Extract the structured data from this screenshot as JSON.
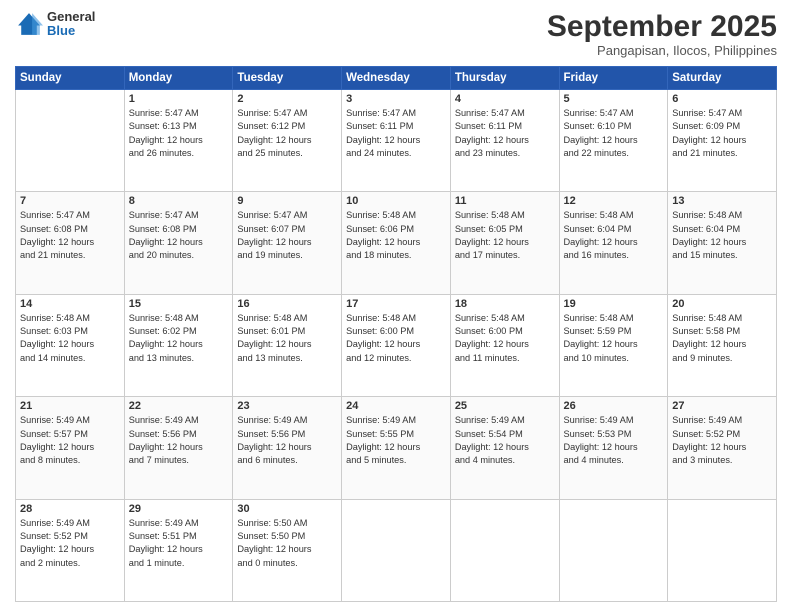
{
  "header": {
    "logo": {
      "general": "General",
      "blue": "Blue"
    },
    "title": "September 2025",
    "location": "Pangapisan, Ilocos, Philippines"
  },
  "calendar": {
    "days": [
      "Sunday",
      "Monday",
      "Tuesday",
      "Wednesday",
      "Thursday",
      "Friday",
      "Saturday"
    ],
    "weeks": [
      [
        {
          "day": "",
          "info": ""
        },
        {
          "day": "1",
          "info": "Sunrise: 5:47 AM\nSunset: 6:13 PM\nDaylight: 12 hours\nand 26 minutes."
        },
        {
          "day": "2",
          "info": "Sunrise: 5:47 AM\nSunset: 6:12 PM\nDaylight: 12 hours\nand 25 minutes."
        },
        {
          "day": "3",
          "info": "Sunrise: 5:47 AM\nSunset: 6:11 PM\nDaylight: 12 hours\nand 24 minutes."
        },
        {
          "day": "4",
          "info": "Sunrise: 5:47 AM\nSunset: 6:11 PM\nDaylight: 12 hours\nand 23 minutes."
        },
        {
          "day": "5",
          "info": "Sunrise: 5:47 AM\nSunset: 6:10 PM\nDaylight: 12 hours\nand 22 minutes."
        },
        {
          "day": "6",
          "info": "Sunrise: 5:47 AM\nSunset: 6:09 PM\nDaylight: 12 hours\nand 21 minutes."
        }
      ],
      [
        {
          "day": "7",
          "info": "Sunrise: 5:47 AM\nSunset: 6:08 PM\nDaylight: 12 hours\nand 21 minutes."
        },
        {
          "day": "8",
          "info": "Sunrise: 5:47 AM\nSunset: 6:08 PM\nDaylight: 12 hours\nand 20 minutes."
        },
        {
          "day": "9",
          "info": "Sunrise: 5:47 AM\nSunset: 6:07 PM\nDaylight: 12 hours\nand 19 minutes."
        },
        {
          "day": "10",
          "info": "Sunrise: 5:48 AM\nSunset: 6:06 PM\nDaylight: 12 hours\nand 18 minutes."
        },
        {
          "day": "11",
          "info": "Sunrise: 5:48 AM\nSunset: 6:05 PM\nDaylight: 12 hours\nand 17 minutes."
        },
        {
          "day": "12",
          "info": "Sunrise: 5:48 AM\nSunset: 6:04 PM\nDaylight: 12 hours\nand 16 minutes."
        },
        {
          "day": "13",
          "info": "Sunrise: 5:48 AM\nSunset: 6:04 PM\nDaylight: 12 hours\nand 15 minutes."
        }
      ],
      [
        {
          "day": "14",
          "info": "Sunrise: 5:48 AM\nSunset: 6:03 PM\nDaylight: 12 hours\nand 14 minutes."
        },
        {
          "day": "15",
          "info": "Sunrise: 5:48 AM\nSunset: 6:02 PM\nDaylight: 12 hours\nand 13 minutes."
        },
        {
          "day": "16",
          "info": "Sunrise: 5:48 AM\nSunset: 6:01 PM\nDaylight: 12 hours\nand 13 minutes."
        },
        {
          "day": "17",
          "info": "Sunrise: 5:48 AM\nSunset: 6:00 PM\nDaylight: 12 hours\nand 12 minutes."
        },
        {
          "day": "18",
          "info": "Sunrise: 5:48 AM\nSunset: 6:00 PM\nDaylight: 12 hours\nand 11 minutes."
        },
        {
          "day": "19",
          "info": "Sunrise: 5:48 AM\nSunset: 5:59 PM\nDaylight: 12 hours\nand 10 minutes."
        },
        {
          "day": "20",
          "info": "Sunrise: 5:48 AM\nSunset: 5:58 PM\nDaylight: 12 hours\nand 9 minutes."
        }
      ],
      [
        {
          "day": "21",
          "info": "Sunrise: 5:49 AM\nSunset: 5:57 PM\nDaylight: 12 hours\nand 8 minutes."
        },
        {
          "day": "22",
          "info": "Sunrise: 5:49 AM\nSunset: 5:56 PM\nDaylight: 12 hours\nand 7 minutes."
        },
        {
          "day": "23",
          "info": "Sunrise: 5:49 AM\nSunset: 5:56 PM\nDaylight: 12 hours\nand 6 minutes."
        },
        {
          "day": "24",
          "info": "Sunrise: 5:49 AM\nSunset: 5:55 PM\nDaylight: 12 hours\nand 5 minutes."
        },
        {
          "day": "25",
          "info": "Sunrise: 5:49 AM\nSunset: 5:54 PM\nDaylight: 12 hours\nand 4 minutes."
        },
        {
          "day": "26",
          "info": "Sunrise: 5:49 AM\nSunset: 5:53 PM\nDaylight: 12 hours\nand 4 minutes."
        },
        {
          "day": "27",
          "info": "Sunrise: 5:49 AM\nSunset: 5:52 PM\nDaylight: 12 hours\nand 3 minutes."
        }
      ],
      [
        {
          "day": "28",
          "info": "Sunrise: 5:49 AM\nSunset: 5:52 PM\nDaylight: 12 hours\nand 2 minutes."
        },
        {
          "day": "29",
          "info": "Sunrise: 5:49 AM\nSunset: 5:51 PM\nDaylight: 12 hours\nand 1 minute."
        },
        {
          "day": "30",
          "info": "Sunrise: 5:50 AM\nSunset: 5:50 PM\nDaylight: 12 hours\nand 0 minutes."
        },
        {
          "day": "",
          "info": ""
        },
        {
          "day": "",
          "info": ""
        },
        {
          "day": "",
          "info": ""
        },
        {
          "day": "",
          "info": ""
        }
      ]
    ]
  }
}
